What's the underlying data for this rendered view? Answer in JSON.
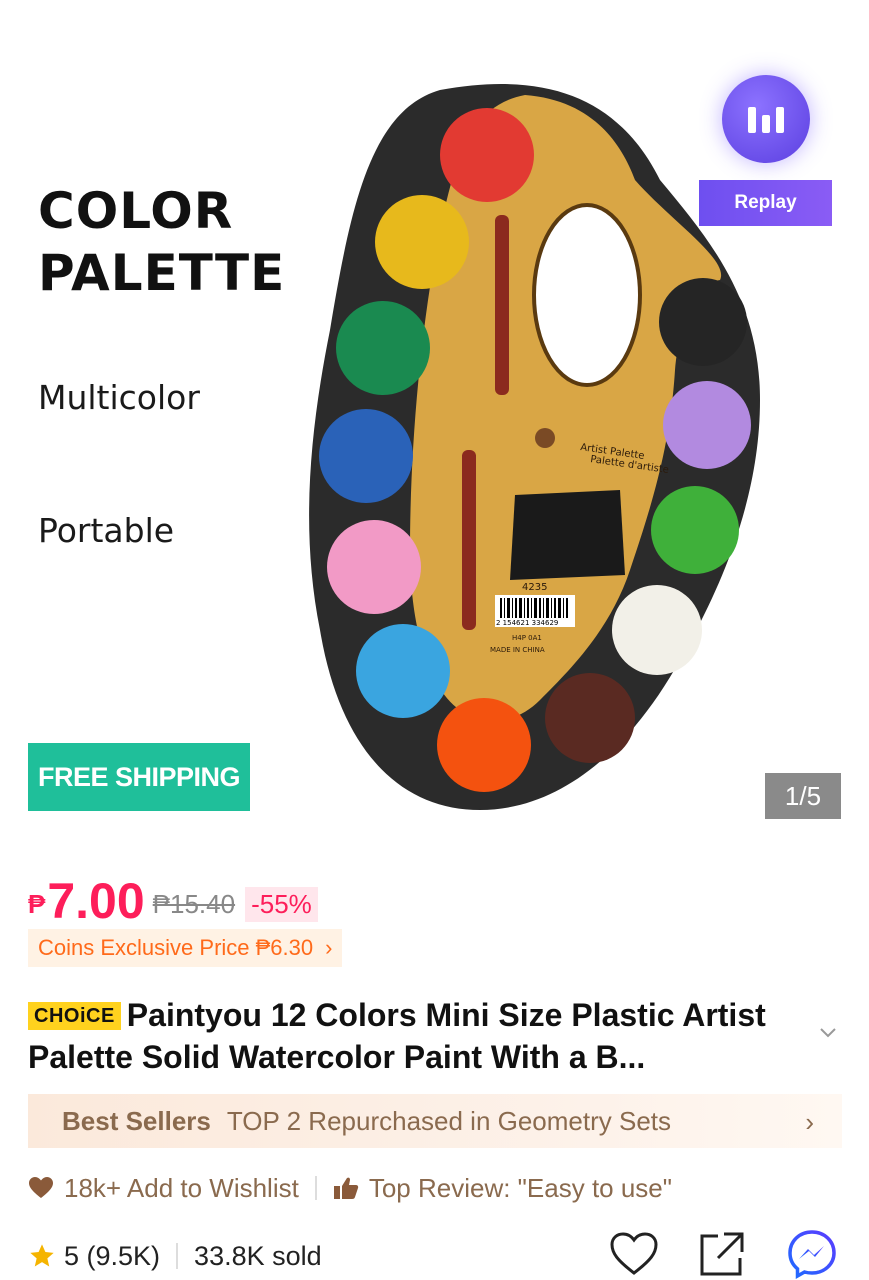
{
  "hero": {
    "title_line1": "COLOR",
    "title_line2": "PALETTE",
    "feature1": "Multicolor",
    "feature2": "Portable",
    "free_shipping": "FREE SHIPPING",
    "replay_label": "Replay",
    "page_counter": "1/5",
    "product_label_line1": "Artist Palette",
    "product_label_line2": "Palette d'artiste",
    "product_code": "4235",
    "barcode": "2 154621 334629",
    "made_in": "MADE IN CHINA",
    "batch": "H4P 0A1"
  },
  "price": {
    "currency": "₱",
    "current": "7.00",
    "original": "₱15.40",
    "discount": "-55%",
    "coins_text": "Coins Exclusive Price ₱6.30",
    "coins_chevron": "›"
  },
  "product": {
    "badge": "CHOiCE",
    "title": "Paintyou 12 Colors Mini Size  Plastic Artist Palette Solid Watercolor Paint With a B..."
  },
  "bestsellers": {
    "label": "Best Sellers",
    "text": "TOP 2 Repurchased in Geometry Sets",
    "chevron": "›"
  },
  "social": {
    "wishlist": "18k+ Add to Wishlist",
    "review": "Top Review: \"Easy to use\""
  },
  "stats": {
    "rating": "5 (9.5K)",
    "sold": "33.8K sold"
  },
  "colors": {
    "accent": "#fd1e5a",
    "free_shipping_bg": "#1fbf9a",
    "brown_text": "#8a6a4e",
    "ai_purple": "#6e4ff0"
  },
  "icons": [
    "bar-chart-icon",
    "heart-icon",
    "thumbs-up-icon",
    "star-icon",
    "wishlist-heart-icon",
    "share-icon",
    "messenger-icon",
    "chevron-down-icon"
  ]
}
